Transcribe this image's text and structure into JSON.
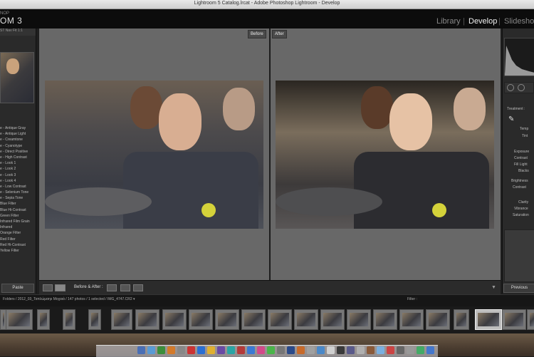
{
  "window": {
    "title": "Lightroom 5 Catalog.lrcat - Adobe Photoshop Lightroom - Develop"
  },
  "brand": {
    "small": "NOP",
    "big": "OM 3"
  },
  "modules": {
    "library": "Library",
    "develop": "Develop",
    "slideshow": "Slideshow",
    "sep": "|"
  },
  "left_panel": {
    "tabs": "ST Nav Fit 1:1",
    "presets": [
      "e - Antique Gray",
      "e - Antique Light",
      "e - Creamtone",
      "e - Cyanotype",
      "e - Direct Positive",
      "e - High Contrast",
      "e - Look 1",
      "e - Look 2",
      "e - Look 3",
      "e - Look 4",
      "e - Low Contrast",
      "e - Selenium Tone",
      "e - Sepia Tone",
      "Blue Filter",
      "Blue Hi-Contrast",
      "Green Filter",
      "Infrared Film Grain",
      "Infrared",
      "Orange Filter",
      "Red Filter",
      "Red Hi-Contrast",
      "Yellow Filter"
    ],
    "paste": "Paste"
  },
  "compare": {
    "before": "Before",
    "after": "After"
  },
  "toolbar": {
    "before_after": "Before & After :"
  },
  "right_panel": {
    "histo_nums": "100 ISO  f/8",
    "treatment": "Treatment :",
    "temp": "Temp",
    "tint": "Tint",
    "exposure": "Exposure",
    "contrast": "Contrast",
    "fill_light": "Fill Light",
    "blacks": "Blacks",
    "brightness": "Brightness",
    "contrast2": "Contrast",
    "clarity": "Clarity",
    "vibrance": "Vibrance",
    "saturation": "Saturation",
    "previous": "Previous"
  },
  "filmstrip": {
    "path": "Folders / 2012_03_Ταπλώμαηs Μοχαιά / 147 photos / 1 selected / IMG_4747.CR2 ▾",
    "filter": "Filter :"
  },
  "colors": {
    "accent": "#d4d23a",
    "panel": "#2a2a2a",
    "center": "#686868"
  }
}
